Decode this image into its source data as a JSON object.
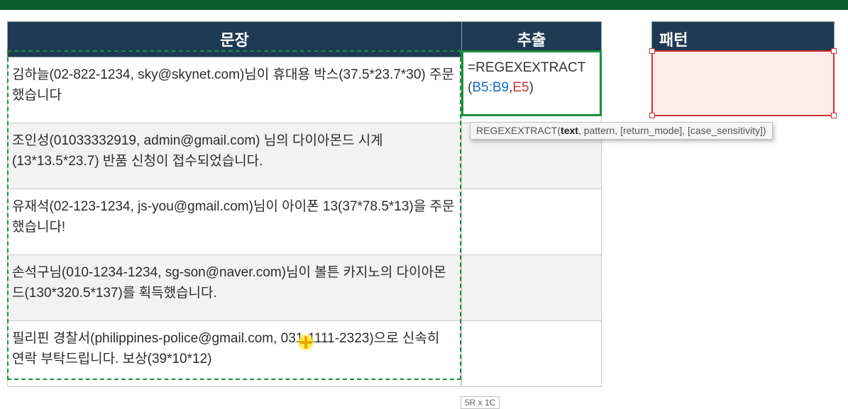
{
  "headers": {
    "sentence": "문장",
    "extract": "추출",
    "pattern": "패턴"
  },
  "rows": [
    "김하늘(02-822-1234, sky@skynet.com)님이 휴대용 박스(37.5*23.7*30) 주문했습니다",
    "조인성(01033332919, admin@gmail.com) 님의 다이아몬드 시계(13*13.5*23.7) 반품 신청이 접수되었습니다.",
    "유재석(02-123-1234, js-you@gmail.com)님이 아이폰 13(37*78.5*13)을 주문했습니다!",
    "손석구님(010-1234-1234, sg-son@naver.com)님이 볼튼 카지노의 다이아몬드(130*320.5*137)를 획득했습니다.",
    "필리핀 경찰서(philippines-police@gmail.com, 031-1111-2323)으로 신속히 연락 부탁드립니다. 보상(39*10*12)"
  ],
  "formula": {
    "eq": "=",
    "fn_open": "REGEXEXTRACT(",
    "ref1": "B5:B9",
    "comma": ",",
    "ref2": "E5",
    "close": ")"
  },
  "tooltip": {
    "fn": "REGEXEXTRACT",
    "open": "(",
    "arg_bold": "text",
    "rest": ", pattern, [return_mode], [case_sensitivity])"
  },
  "dim_badge": "5R x 1C"
}
